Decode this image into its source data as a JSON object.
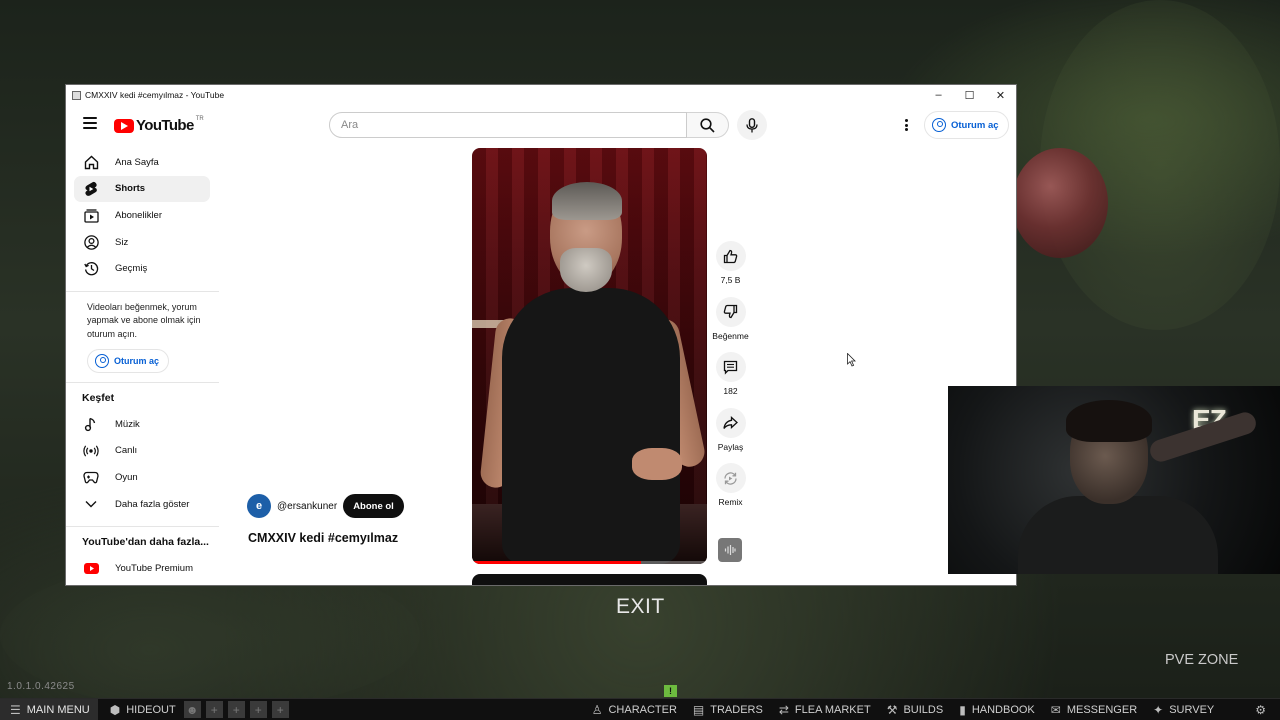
{
  "window": {
    "title": "CMXXIV kedi #cemyılmaz - YouTube",
    "controls": [
      "–",
      "☐",
      "✕"
    ]
  },
  "header": {
    "logo_text": "YouTube",
    "country_code": "TR",
    "search_placeholder": "Ara",
    "signin_label": "Oturum aç"
  },
  "sidebar": {
    "items": [
      {
        "label": "Ana Sayfa",
        "icon": "home-icon"
      },
      {
        "label": "Shorts",
        "icon": "shorts-icon",
        "active": true
      },
      {
        "label": "Abonelikler",
        "icon": "subscriptions-icon"
      },
      {
        "label": "Siz",
        "icon": "user-icon"
      },
      {
        "label": "Geçmiş",
        "icon": "history-icon"
      }
    ],
    "signin_note": "Videoları beğenmek, yorum yapmak ve abone olmak için oturum açın.",
    "signin_label": "Oturum aç",
    "explore_heading": "Keşfet",
    "explore_items": [
      {
        "label": "Müzik",
        "icon": "music-icon"
      },
      {
        "label": "Canlı",
        "icon": "live-icon"
      },
      {
        "label": "Oyun",
        "icon": "gaming-icon"
      },
      {
        "label": "Daha fazla göster",
        "icon": "chevron-down-icon"
      }
    ],
    "more_heading": "YouTube'dan daha fazla...",
    "more_items": [
      {
        "label": "YouTube Premium",
        "icon": "youtube-premium-icon"
      }
    ]
  },
  "short": {
    "channel_initial": "e",
    "channel_handle": "@ersankuner",
    "subscribe_label": "Abone ol",
    "title": "CMXXIV kedi #cemyılmaz",
    "progress": 0.72,
    "actions": [
      {
        "label": "7,5 B",
        "icon": "thumbs-up-icon"
      },
      {
        "label": "Beğenme",
        "icon": "thumbs-down-icon"
      },
      {
        "label": "182",
        "icon": "comment-icon"
      },
      {
        "label": "Paylaş",
        "icon": "share-icon"
      },
      {
        "label": "Remix",
        "icon": "remix-icon"
      }
    ]
  },
  "game": {
    "exit_label": "EXIT",
    "zone_label": "PVE ZONE",
    "version": "1.0.1.0.42625",
    "stream_logo": "EZ",
    "notification": "!",
    "taskbar": {
      "main_menu": "MAIN MENU",
      "hideout": "HIDEOUT",
      "character": "CHARACTER",
      "traders": "TRADERS",
      "flea_market": "FLEA MARKET",
      "builds": "BUILDS",
      "handbook": "HANDBOOK",
      "messenger": "MESSENGER",
      "survey": "SURVEY"
    }
  },
  "colors": {
    "youtube_red": "#ff0000",
    "link_blue": "#065fd4",
    "game_bg": "#1f2620"
  }
}
